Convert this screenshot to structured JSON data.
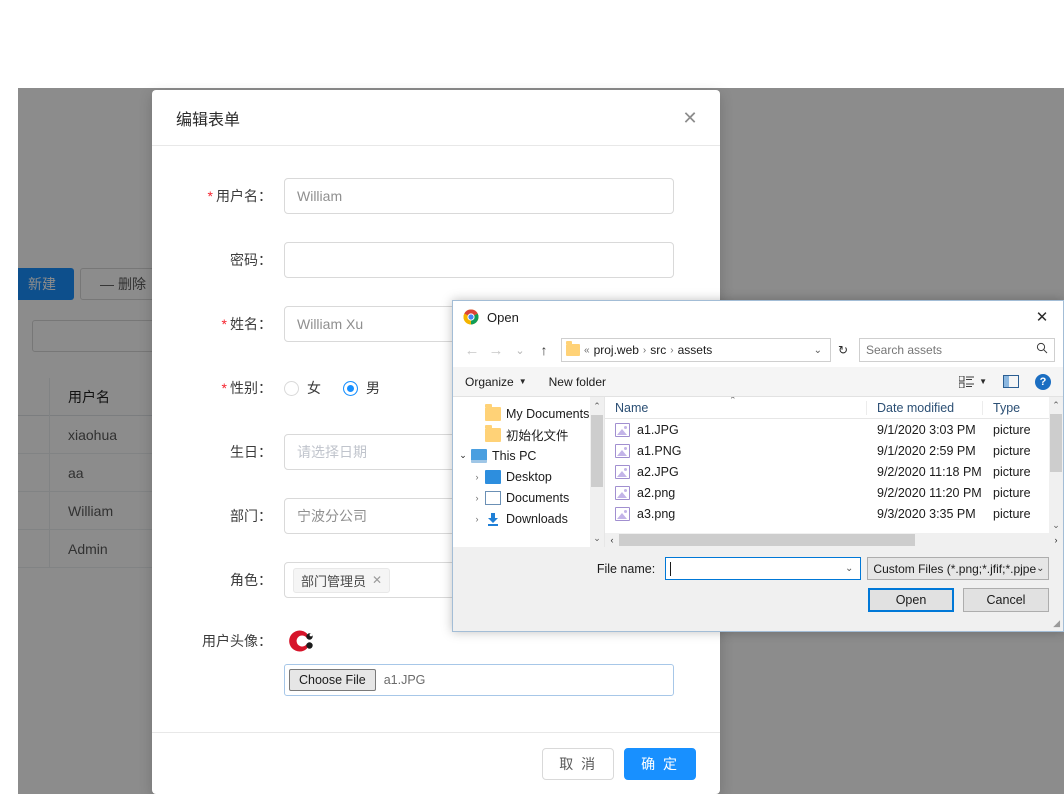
{
  "background_app": {
    "buttons": [
      {
        "label": "新建",
        "icon": "plus-icon"
      },
      {
        "label": "删除",
        "icon": "minus-icon"
      }
    ],
    "filter_label": "：",
    "table": {
      "columns": [
        "用户名"
      ],
      "rows": [
        {
          "username": "xiaohua"
        },
        {
          "username": "aa"
        },
        {
          "username": "William"
        },
        {
          "username": "Admin"
        }
      ]
    }
  },
  "modal": {
    "title": "编辑表单",
    "close_icon": "close-icon",
    "fields": {
      "username": {
        "label": "用户名：",
        "required": true,
        "value": "William"
      },
      "password": {
        "label": "密码：",
        "required": false,
        "value": ""
      },
      "fullname": {
        "label": "姓名：",
        "required": true,
        "value": "William Xu"
      },
      "gender": {
        "label": "性别：",
        "required": true,
        "options": [
          {
            "label": "女",
            "selected": false
          },
          {
            "label": "男",
            "selected": true
          }
        ]
      },
      "birthday": {
        "label": "生日：",
        "required": false,
        "placeholder": "请选择日期",
        "icon": "calendar-icon"
      },
      "department": {
        "label": "部门：",
        "required": false,
        "value": "宁波分公司"
      },
      "role": {
        "label": "角色：",
        "required": false,
        "tag": "部门管理员",
        "tag_remove_icon": "tag-close-icon"
      },
      "avatar": {
        "label": "用户头像：",
        "image_alt": "magnet-logo",
        "choose_button": "Choose File",
        "file_name": "a1.JPG"
      }
    },
    "footer": {
      "cancel": "取 消",
      "confirm": "确 定"
    }
  },
  "open_dialog": {
    "title": "Open",
    "app_icon": "chrome-icon",
    "close_icon": "close-icon",
    "nav": {
      "back_icon": "back-arrow-icon",
      "forward_icon": "forward-arrow-icon",
      "recent_icon": "chevron-down-icon",
      "up_icon": "up-arrow-icon",
      "breadcrumb_prefix": "«",
      "breadcrumb": [
        "proj.web",
        "src",
        "assets"
      ],
      "breadcrumb_separator": "›",
      "address_dropdown_icon": "chevron-down-icon",
      "refresh_icon": "refresh-icon",
      "search_placeholder": "Search assets",
      "search_icon": "search-icon"
    },
    "toolbar": {
      "organize": "Organize",
      "organize_caret": "caret-down-icon",
      "new_folder": "New folder",
      "view_icon": "view-list-icon",
      "view_caret": "caret-down-icon",
      "preview_pane_icon": "preview-pane-icon",
      "help_icon": "help-icon",
      "help_glyph": "?"
    },
    "tree": [
      {
        "label": "My Documents",
        "icon": "folder-icon",
        "expander": "",
        "indent": 1
      },
      {
        "label": "初始化文件",
        "icon": "folder-icon",
        "expander": "",
        "indent": 1
      },
      {
        "label": "This PC",
        "icon": "pc-icon",
        "expander": "⌄",
        "indent": 0
      },
      {
        "label": "Desktop",
        "icon": "desktop-icon",
        "expander": "›",
        "indent": 1
      },
      {
        "label": "Documents",
        "icon": "documents-icon",
        "expander": "›",
        "indent": 1
      },
      {
        "label": "Downloads",
        "icon": "downloads-icon",
        "expander": "›",
        "indent": 1
      }
    ],
    "columns": [
      "Name",
      "Date modified",
      "Type"
    ],
    "files": [
      {
        "name": "a1.JPG",
        "date": "9/1/2020 3:03 PM",
        "type": "picture",
        "icon": "image-file-icon"
      },
      {
        "name": "a1.PNG",
        "date": "9/1/2020 2:59 PM",
        "type": "picture",
        "icon": "image-file-icon"
      },
      {
        "name": "a2.JPG",
        "date": "9/2/2020 11:18 PM",
        "type": "picture",
        "icon": "image-file-icon"
      },
      {
        "name": "a2.png",
        "date": "9/2/2020 11:20 PM",
        "type": "picture",
        "icon": "image-file-icon"
      },
      {
        "name": "a3.png",
        "date": "9/3/2020 3:35 PM",
        "type": "picture",
        "icon": "image-file-icon"
      }
    ],
    "bottom": {
      "file_name_label": "File name:",
      "file_name_value": "",
      "file_name_dropdown_icon": "chevron-down-icon",
      "filter_value": "Custom Files (*.png;*.jfif;*.pjpe",
      "filter_dropdown_icon": "chevron-down-icon",
      "open_button": "Open",
      "cancel_button": "Cancel"
    }
  },
  "colors": {
    "primary": "#1890ff",
    "required_star": "#f5222d",
    "win_accent": "#0078d7",
    "folder_yellow": "#ffd277",
    "avatar_red": "#d6142a"
  }
}
